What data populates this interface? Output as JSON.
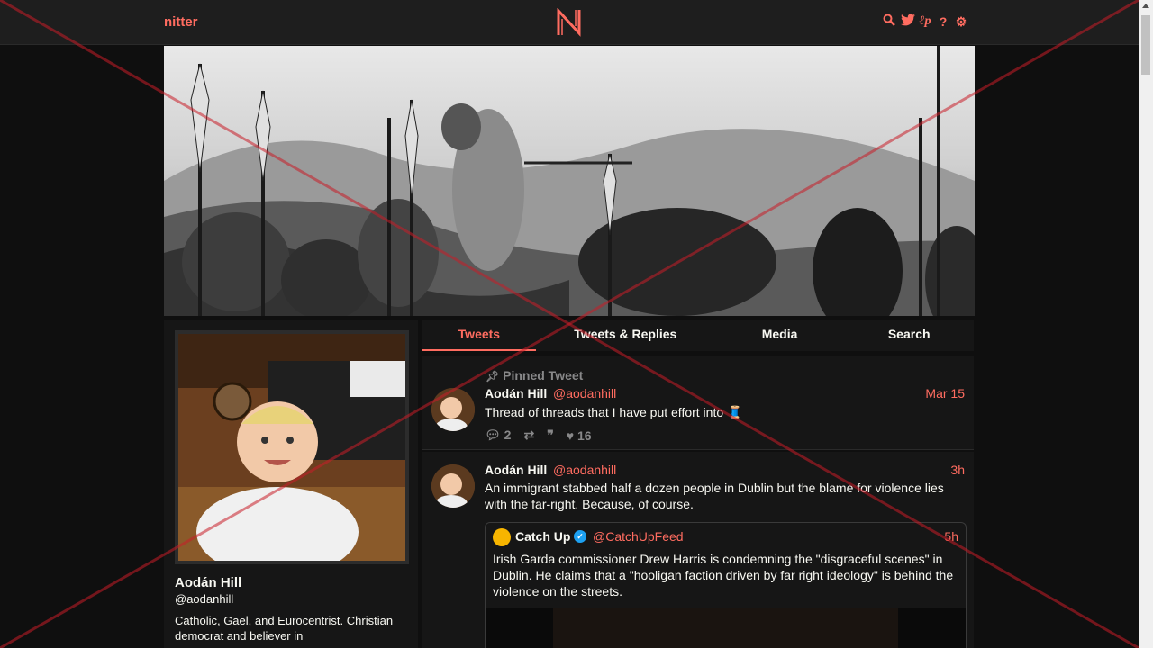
{
  "navbar": {
    "brand": "nitter",
    "logo_letter": "N",
    "icons": [
      "search-icon",
      "twitter-bird-icon",
      "rss-icon",
      "help-icon",
      "gear-icon"
    ],
    "accent_color": "#ff6c60"
  },
  "profile": {
    "name": "Aodán Hill",
    "handle": "@aodanhill",
    "bio": "Catholic, Gael, and Eurocentrist. Christian democrat and believer in"
  },
  "tabs": [
    {
      "label": "Tweets",
      "active": true
    },
    {
      "label": "Tweets & Replies",
      "active": false
    },
    {
      "label": "Media",
      "active": false
    },
    {
      "label": "Search",
      "active": false
    }
  ],
  "tweets": [
    {
      "pinned_label": "Pinned Tweet",
      "name": "Aodán Hill",
      "handle": "@aodanhill",
      "date": "Mar 15",
      "text": "Thread of threads that I have put effort into 🧵",
      "replies": "2",
      "likes": "16"
    },
    {
      "name": "Aodán Hill",
      "handle": "@aodanhill",
      "date": "3h",
      "text": "An immigrant stabbed half a dozen people in Dublin but the blame for violence lies with the far-right. Because, of course.",
      "quote": {
        "name": "Catch Up",
        "handle": "@CatchUpFeed",
        "date": "5h",
        "text": "Irish Garda commissioner Drew Harris is condemning the \"disgraceful scenes\" in Dublin. He claims that a \"hooligan faction driven by far right ideology\" is behind the violence on the streets."
      }
    }
  ]
}
